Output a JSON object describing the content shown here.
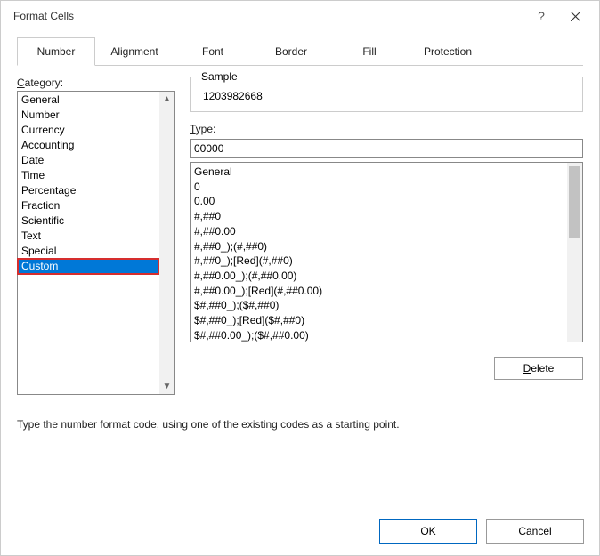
{
  "title": "Format Cells",
  "tabs": {
    "number": "Number",
    "alignment": "Alignment",
    "font": "Font",
    "border": "Border",
    "fill": "Fill",
    "protection": "Protection"
  },
  "category_label": "Category:",
  "categories": {
    "general": "General",
    "number": "Number",
    "currency": "Currency",
    "accounting": "Accounting",
    "date": "Date",
    "time": "Time",
    "percentage": "Percentage",
    "fraction": "Fraction",
    "scientific": "Scientific",
    "text": "Text",
    "special": "Special",
    "custom": "Custom"
  },
  "sample_label": "Sample",
  "sample_value": "1203982668",
  "type_label": "Type:",
  "type_value": "00000",
  "type_options": [
    "General",
    "0",
    "0.00",
    "#,##0",
    "#,##0.00",
    "#,##0_);(#,##0)",
    "#,##0_);[Red](#,##0)",
    "#,##0.00_);(#,##0.00)",
    "#,##0.00_);[Red](#,##0.00)",
    "$#,##0_);($#,##0)",
    "$#,##0_);[Red]($#,##0)",
    "$#,##0.00_);($#,##0.00)"
  ],
  "delete_label": "Delete",
  "hint_text": "Type the number format code, using one of the existing codes as a starting point.",
  "ok_label": "OK",
  "cancel_label": "Cancel"
}
